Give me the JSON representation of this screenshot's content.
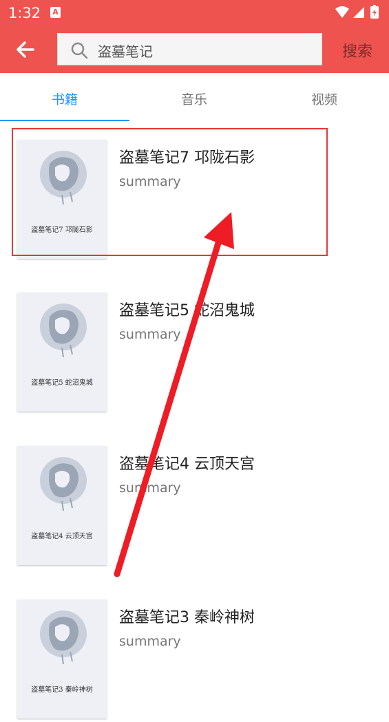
{
  "status_bar": {
    "time": "1:32",
    "notification_icon": "A"
  },
  "header": {
    "search_query": "盗墓笔记",
    "search_button": "搜索",
    "accent_color": "#ef5350"
  },
  "tabs": [
    {
      "label": "书籍",
      "active": true
    },
    {
      "label": "音乐",
      "active": false
    },
    {
      "label": "视频",
      "active": false
    }
  ],
  "books": [
    {
      "title": "盗墓笔记7 邛陇石影",
      "summary": "summary",
      "cover_text": "盗墓笔记7  邛陇石影"
    },
    {
      "title": "盗墓笔记5 蛇沼鬼城",
      "summary": "summary",
      "cover_text": "盗墓笔记5  蛇沼鬼城"
    },
    {
      "title": "盗墓笔记4 云顶天宫",
      "summary": "summary",
      "cover_text": "盗墓笔记4  云顶天宫"
    },
    {
      "title": "盗墓笔记3 秦岭神树",
      "summary": "summary",
      "cover_text": "盗墓笔记3  秦岭神树"
    }
  ]
}
